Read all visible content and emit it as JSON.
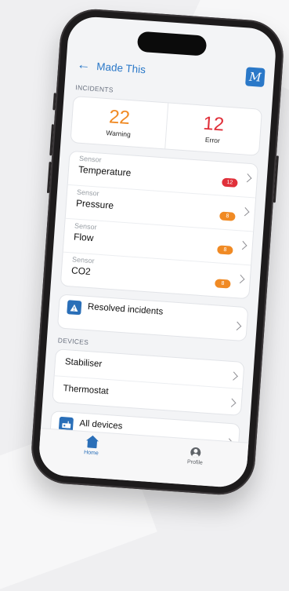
{
  "header": {
    "title": "Made This",
    "logo_text": "M"
  },
  "incidents": {
    "section_label": "INCIDENTS",
    "warning": {
      "count": "22",
      "label": "Warning",
      "color": "#f08a24"
    },
    "error": {
      "count": "12",
      "label": "Error",
      "color": "#e0303a"
    },
    "sensors": [
      {
        "kicker": "Sensor",
        "name": "Temperature",
        "badge": "12",
        "badge_color": "#e0303a"
      },
      {
        "kicker": "Sensor",
        "name": "Pressure",
        "badge": "8",
        "badge_color": "#f08a24"
      },
      {
        "kicker": "Sensor",
        "name": "Flow",
        "badge": "8",
        "badge_color": "#f08a24"
      },
      {
        "kicker": "Sensor",
        "name": "CO2",
        "badge": "8",
        "badge_color": "#f08a24"
      }
    ],
    "resolved_label": "Resolved incidents"
  },
  "devices": {
    "section_label": "DEVICES",
    "items": [
      "Stabiliser",
      "Thermostat"
    ],
    "all_label": "All devices"
  },
  "tabs": [
    {
      "label": "Home",
      "active": true,
      "color": "#2a6fb8"
    },
    {
      "label": "Profile",
      "active": false,
      "color": "#5f6368"
    }
  ]
}
